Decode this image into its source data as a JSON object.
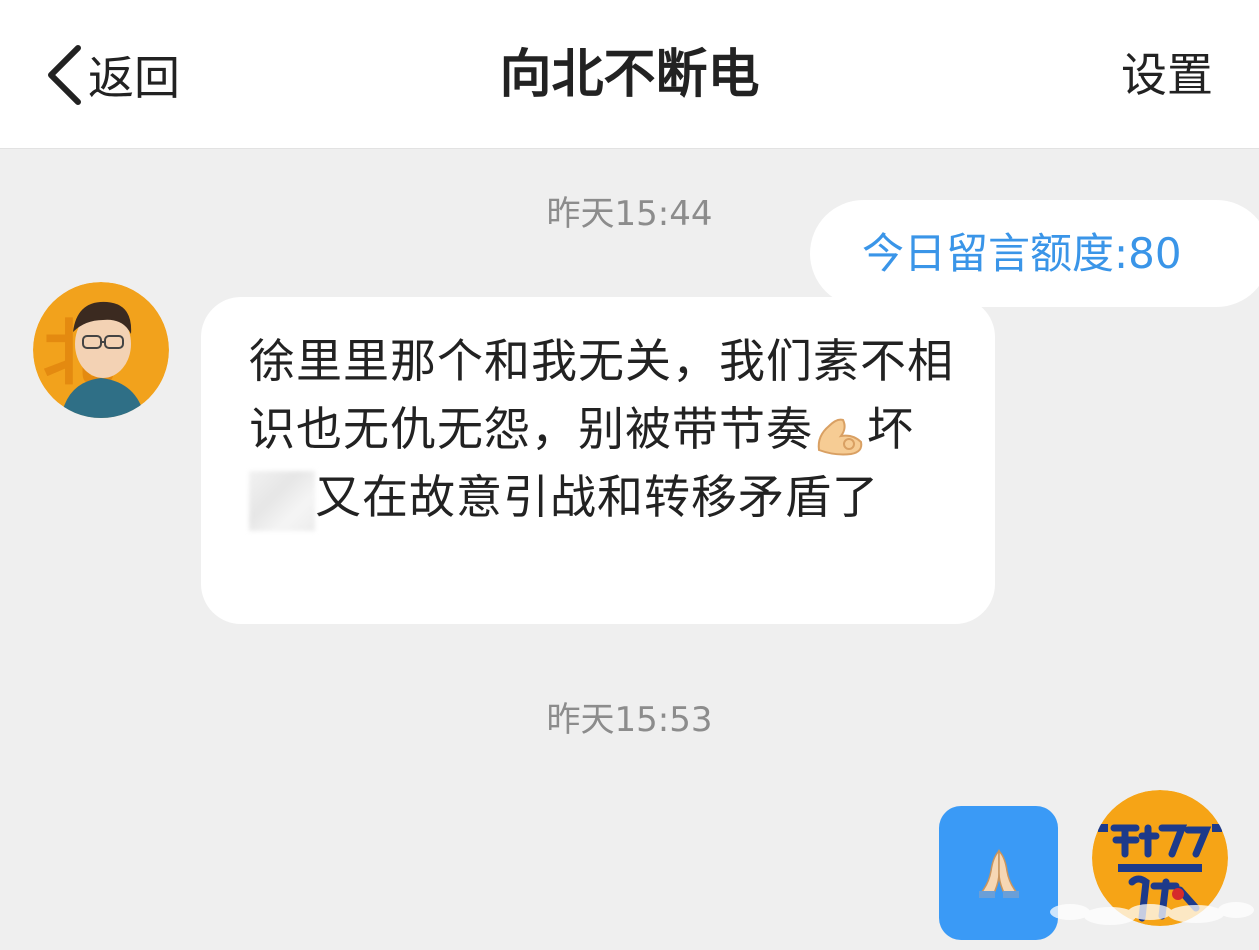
{
  "header": {
    "back_label": "返回",
    "title": "向北不断电",
    "settings_label": "设置"
  },
  "messages": {
    "timestamp_1": "昨天15:44",
    "quota_text": "今日留言额度:80",
    "incoming_text_part1": "徐里里那个和我无关，我们素不相识也无仇无怨，别被带节奏",
    "incoming_text_part2": "坏",
    "incoming_text_part3": "又在故意引战和转移矛盾了",
    "timestamp_2": "昨天15:53",
    "outgoing_emoji_icon": "folded-hands-icon"
  },
  "colors": {
    "header_bg": "#ffffff",
    "chat_bg": "#efefef",
    "quota_text": "#3a95e8",
    "outgoing_bubble": "#3a9af6",
    "timestamp": "#8c8c8c"
  }
}
